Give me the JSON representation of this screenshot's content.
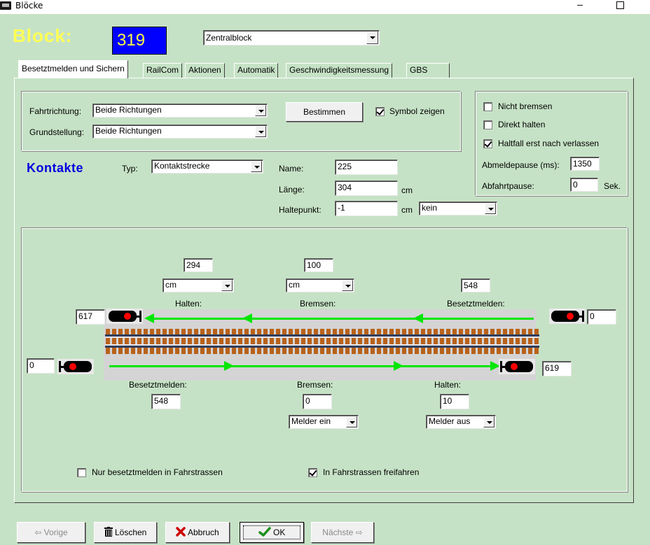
{
  "window": {
    "title": "Blöcke"
  },
  "header": {
    "block_label": "Block:",
    "block_number": "319",
    "block_name": "Zentralblock"
  },
  "tabs": [
    {
      "label": "Besetztmelden und Sichern",
      "active": true
    },
    {
      "label": "RailCom",
      "active": false
    },
    {
      "label": "Aktionen",
      "active": false
    },
    {
      "label": "Automatik",
      "active": false
    },
    {
      "label": "Geschwindigkeitsmessung",
      "active": false
    },
    {
      "label": "GBS",
      "active": false
    }
  ],
  "direction": {
    "fahrtrichtung_label": "Fahrtrichtung:",
    "fahrtrichtung_value": "Beide Richtungen",
    "grundstellung_label": "Grundstellung:",
    "grundstellung_value": "Beide Richtungen",
    "bestimmen_button": "Bestimmen",
    "symbol_zeigen_label": "Symbol zeigen",
    "symbol_zeigen_checked": true
  },
  "braking": {
    "nicht_bremsen_label": "Nicht bremsen",
    "nicht_bremsen_checked": false,
    "direkt_halten_label": "Direkt halten",
    "direkt_halten_checked": false,
    "haltfall_label": "Haltfall erst nach verlassen",
    "haltfall_checked": true,
    "abmeldepause_label": "Abmeldepause (ms):",
    "abmeldepause_value": "1350",
    "abfahrtpause_label": "Abfahrtpause:",
    "abfahrtpause_value": "0",
    "abfahrtpause_unit": "Sek."
  },
  "contacts": {
    "heading": "Kontakte",
    "typ_label": "Typ:",
    "typ_value": "Kontaktstrecke",
    "name_label": "Name:",
    "name_value": "225",
    "laenge_label": "Länge:",
    "laenge_value": "304",
    "laenge_unit": "cm",
    "haltepunkt_label": "Haltepunkt:",
    "haltepunkt_value": "-1",
    "haltepunkt_unit": "cm",
    "haltepunkt_mode": "kein"
  },
  "track_top": {
    "halten_value": "294",
    "halten_unit": "cm",
    "bremsen_value": "100",
    "bremsen_unit": "cm",
    "besetztmelden_value": "548",
    "halten_label": "Halten:",
    "bremsen_label": "Bremsen:",
    "besetztmelden_label": "Besetztmelden:",
    "left_signal_value": "617",
    "right_signal_value": "0"
  },
  "track_bottom": {
    "left_signal_value": "0",
    "right_signal_value": "619",
    "besetztmelden_label": "Besetztmelden:",
    "besetztmelden_value": "548",
    "bremsen_label": "Bremsen:",
    "bremsen_value": "0",
    "bremsen_mode": "Melder ein",
    "halten_label": "Halten:",
    "halten_value": "10",
    "halten_mode": "Melder aus"
  },
  "options": {
    "nur_besetztmelden_label": "Nur besetztmelden in Fahrstrassen",
    "nur_besetztmelden_checked": false,
    "freifahren_label": "In Fahrstrassen freifahren",
    "freifahren_checked": true
  },
  "footer": {
    "vorige_label": "Vorige",
    "loeschen_label": "Löschen",
    "abbruch_label": "Abbruch",
    "ok_label": "OK",
    "naechste_label": "Nächste"
  },
  "colors": {
    "background": "#c6e2c6",
    "block_title": "#ffff55",
    "block_number_bg": "#0000ff",
    "kontakte_heading": "#0000e0",
    "arrow_green": "#00e600",
    "signal_red": "#ff0000",
    "sleeper_brown": "#b8621b",
    "abbruch_red": "#cc0000",
    "ok_green": "#1a8f1a"
  },
  "icons": {
    "window": "app-window-icon",
    "minimize": "minimize-icon",
    "maximize": "maximize-icon",
    "signal": "signal-icon",
    "trash": "trash-icon",
    "cancel": "cross-icon",
    "ok": "checkmark-icon",
    "prev": "arrow-left-icon",
    "next": "arrow-right-icon"
  }
}
